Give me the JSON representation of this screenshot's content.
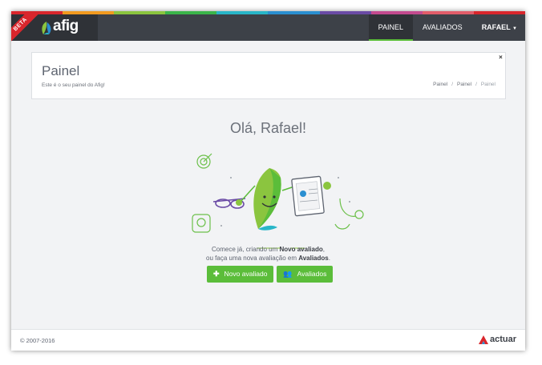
{
  "header": {
    "beta_badge": "BETA",
    "logo_text": "afig",
    "nav": {
      "painel": "PAINEL",
      "avaliados": "AVALIADOS",
      "user": "RAFAEL"
    },
    "rainbow_colors": [
      "#d9262c",
      "#f29a1f",
      "#8bc53f",
      "#3bb54a",
      "#28b6c8",
      "#2a8fd1",
      "#6a4aa5",
      "#c34a8f",
      "#e25d6a",
      "#d9262c"
    ]
  },
  "page": {
    "title": "Painel",
    "subtitle": "Este é o seu painel do Afig!",
    "breadcrumb": [
      "Painel",
      "Painel",
      "Painel"
    ],
    "close": "×"
  },
  "main": {
    "greeting": "Olá, Rafael!",
    "message": {
      "line1_pre": "Comece já, criando um ",
      "line1_bold": "Novo avaliado",
      "line1_post": ",",
      "line2_pre": "ou faça uma nova avaliação em ",
      "line2_bold": "Avaliados",
      "line2_post": "."
    },
    "buttons": {
      "new": "Novo avaliado",
      "list": "Avaliados"
    },
    "accent": "#5bbd3a"
  },
  "footer": {
    "copyright": "© 2007-2016",
    "brand": "actuar"
  }
}
